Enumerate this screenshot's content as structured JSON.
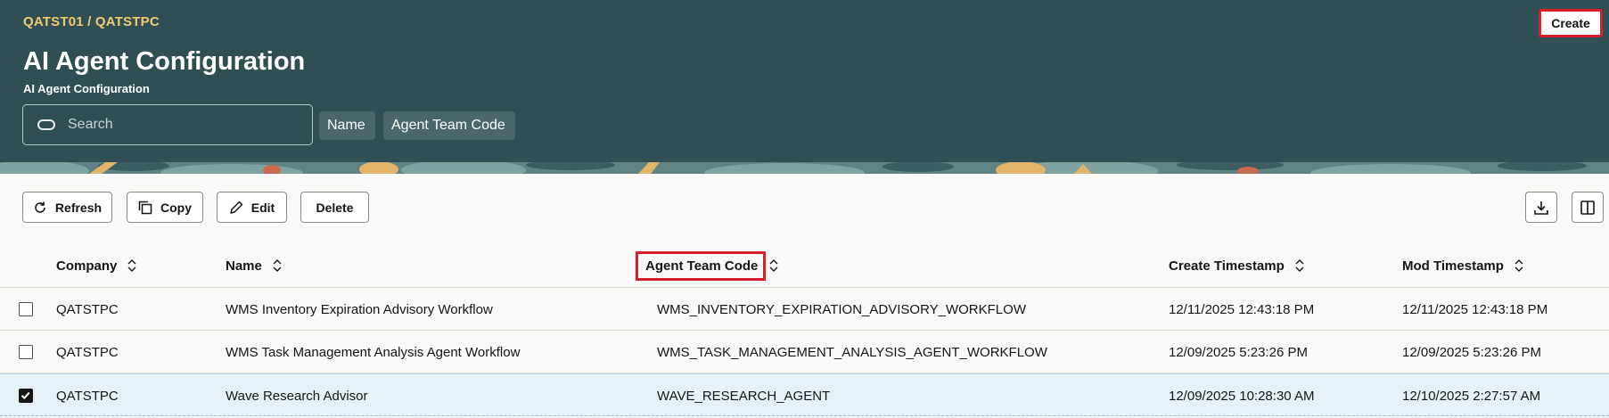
{
  "header": {
    "breadcrumb": "QATST01 / QATSTPC",
    "title": "AI Agent Configuration",
    "subtitle": "AI Agent Configuration",
    "create_label": "Create",
    "search": {
      "placeholder": "Search",
      "value": ""
    },
    "filter_chips": [
      "Name",
      "Agent Team Code"
    ],
    "colors": {
      "background": "#304f55",
      "breadcrumb": "#f0cc71",
      "highlight": "#d61f2b"
    }
  },
  "toolbar": {
    "refresh_label": "Refresh",
    "copy_label": "Copy",
    "edit_label": "Edit",
    "delete_label": "Delete",
    "icons": [
      "refresh-icon",
      "copy-icon",
      "pencil-icon",
      "download-icon",
      "columns-icon"
    ]
  },
  "table": {
    "columns": [
      "Company",
      "Name",
      "Agent Team Code",
      "Create Timestamp",
      "Mod Timestamp"
    ],
    "rows": [
      {
        "checked": false,
        "company": "QATSTPC",
        "name": "WMS Inventory Expiration Advisory Workflow",
        "agent_team_code": "WMS_INVENTORY_EXPIRATION_ADVISORY_WORKFLOW",
        "create_timestamp": "12/11/2025 12:43:18 PM",
        "mod_timestamp": "12/11/2025 12:43:18 PM"
      },
      {
        "checked": false,
        "company": "QATSTPC",
        "name": "WMS Task Management Analysis Agent Workflow",
        "agent_team_code": "WMS_TASK_MANAGEMENT_ANALYSIS_AGENT_WORKFLOW",
        "create_timestamp": "12/09/2025 5:23:26 PM",
        "mod_timestamp": "12/09/2025 5:23:26 PM"
      },
      {
        "checked": true,
        "company": "QATSTPC",
        "name": "Wave Research Advisor",
        "agent_team_code": "WAVE_RESEARCH_AGENT",
        "create_timestamp": "12/09/2025 10:28:30 AM",
        "mod_timestamp": "12/10/2025 2:27:57 AM"
      }
    ]
  }
}
